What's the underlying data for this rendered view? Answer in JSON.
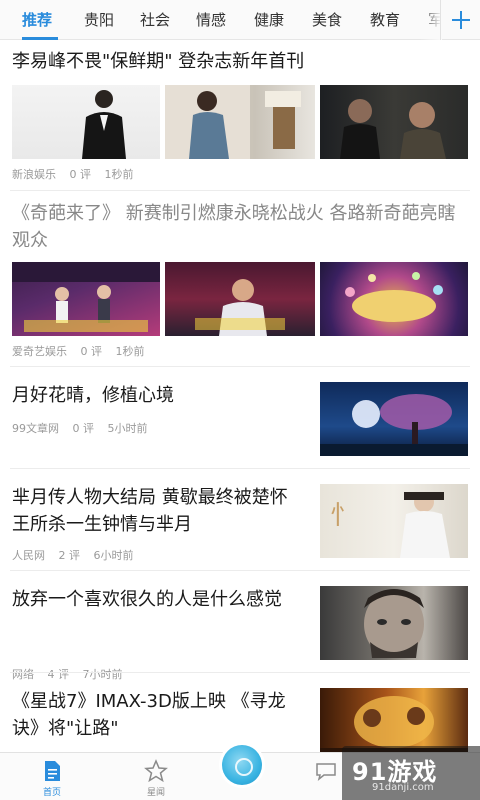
{
  "tabs": [
    {
      "label": "推荐",
      "active": true
    },
    {
      "label": "贵阳"
    },
    {
      "label": "社会"
    },
    {
      "label": "情感"
    },
    {
      "label": "健康"
    },
    {
      "label": "美食"
    },
    {
      "label": "教育"
    },
    {
      "label": "军"
    }
  ],
  "accent_color": "#2a8cdc",
  "feed": [
    {
      "title": "李易峰不畏\"保鲜期\" 登杂志新年首刊",
      "source": "新浪娱乐",
      "comments": "0 评",
      "time": "1秒前",
      "images": 3
    },
    {
      "title": "《奇葩来了》 新赛制引燃康永晓松战火 各路新奇葩亮瞎观众",
      "source": "爱奇艺娱乐",
      "comments": "0 评",
      "time": "1秒前",
      "images": 3,
      "read": true
    },
    {
      "title": "月好花晴，修植心境",
      "source": "99文章网",
      "comments": "0 评",
      "time": "5小时前",
      "images": 1
    },
    {
      "title": "芈月传人物大结局 黄歇最终被楚怀王所杀一生钟情与芈月",
      "source": "人民网",
      "comments": "2 评",
      "time": "6小时前",
      "images": 1
    },
    {
      "title": "放弃一个喜欢很久的人是什么感觉",
      "source": "网络",
      "comments": "4 评",
      "time": "7小时前",
      "images": 1
    },
    {
      "title": "《星战7》IMAX-3D版上映 《寻龙诀》将\"让路\"",
      "images": 1
    }
  ],
  "bottom_nav": [
    {
      "label": "首页",
      "icon": "home-doc-icon",
      "active": true
    },
    {
      "label": "星闻",
      "icon": "star-icon"
    },
    {
      "label": "",
      "icon": "center-circle-icon"
    },
    {
      "label": "",
      "icon": "chat-bubble-icon"
    }
  ],
  "watermark": {
    "main": "91游戏",
    "sub": "91danji.com"
  }
}
